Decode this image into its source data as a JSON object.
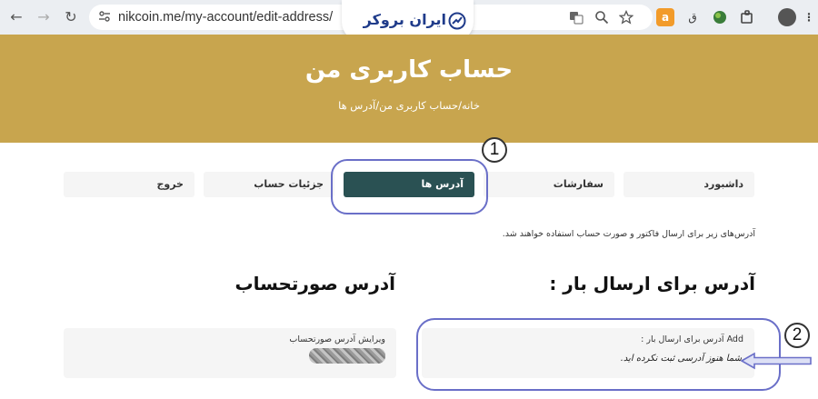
{
  "browser": {
    "url": "nikcoin.me/my-account/edit-address/",
    "back_icon": "←",
    "forward_icon": "→",
    "reload_icon": "↻"
  },
  "logo": {
    "text": "ایران بروکر"
  },
  "hero": {
    "title": "حساب کاربری من",
    "breadcrumb": "خانه/حساب کاربری من/آدرس ها",
    "background": "#c8a54e"
  },
  "tabs": [
    {
      "label": "داشبورد"
    },
    {
      "label": "سفارشات"
    },
    {
      "label": "آدرس ها",
      "active": true
    },
    {
      "label": "جزئیات حساب"
    },
    {
      "label": "خروج"
    }
  ],
  "accent": "#2a5153",
  "notice": "آدرس‌های زیر برای ارسال فاکتور و صورت حساب استفاده خواهند شد.",
  "shipping": {
    "title": "آدرس برای ارسال بار :",
    "card_head": "Add آدرس برای ارسال بار :",
    "empty_text": "شما هنوز آدرسی ثبت نکرده اید."
  },
  "billing": {
    "title": "آدرس صورتحساب",
    "card_head": "ویرایش آدرس صورتحساب"
  },
  "annotations": {
    "label_1": "1",
    "label_2": "2",
    "color": "#6a6fc8"
  }
}
